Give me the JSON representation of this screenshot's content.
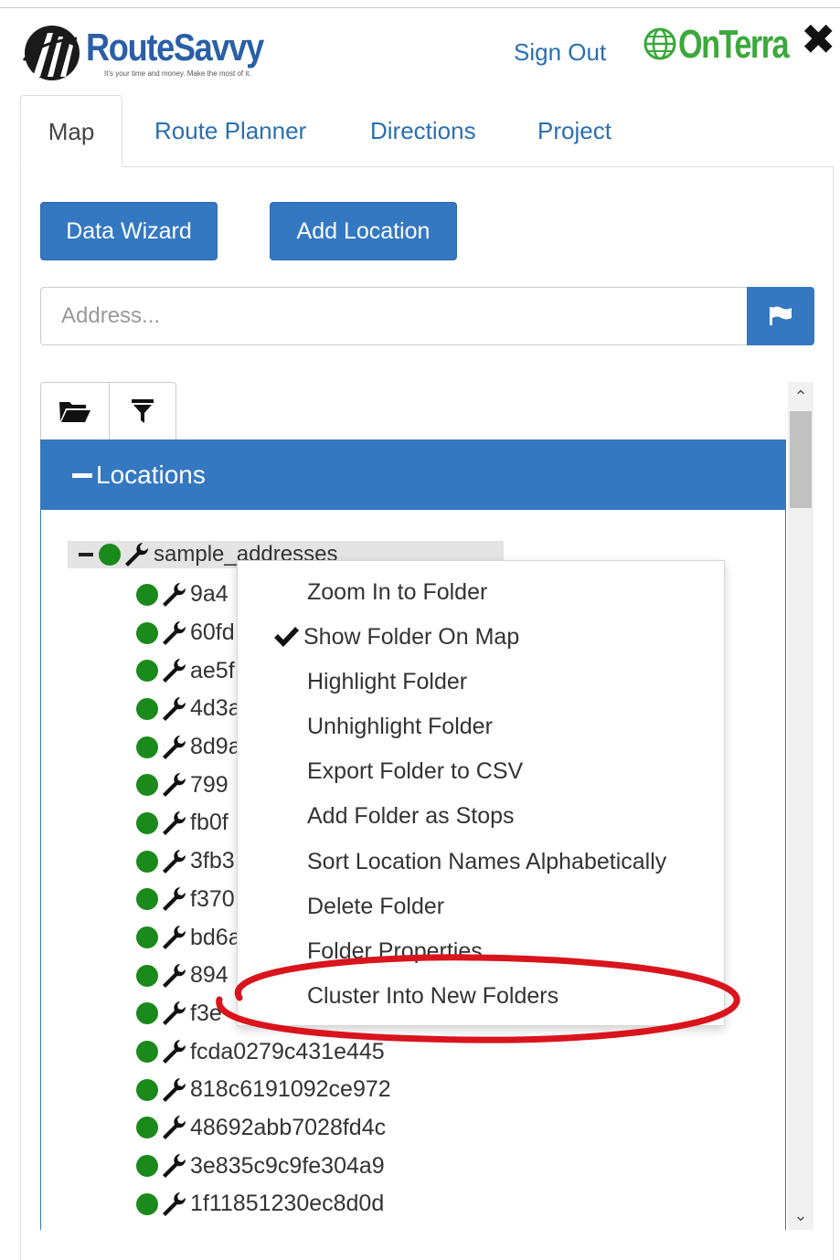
{
  "header": {
    "logo_name": "RouteSavvy",
    "logo_tagline": "It's your time and money. Make the most of it.",
    "sign_out": "Sign Out",
    "partner_logo": "OnTerra",
    "close_icon": "close-icon"
  },
  "tabs": [
    {
      "label": "Map",
      "active": true
    },
    {
      "label": "Route Planner",
      "active": false
    },
    {
      "label": "Directions",
      "active": false
    },
    {
      "label": "Project",
      "active": false
    }
  ],
  "buttons": {
    "data_wizard": "Data Wizard",
    "add_location": "Add Location"
  },
  "address": {
    "placeholder": "Address...",
    "value": "",
    "submit_icon": "flag-icon"
  },
  "toolbar": {
    "open_icon": "folder-open-icon",
    "filter_icon": "filter-icon"
  },
  "locations": {
    "header": "Locations",
    "folder": "sample_addresses",
    "items": [
      "9a4",
      "60fd",
      "ae5f",
      "4d3a",
      "8d9a",
      "799",
      "fb0f",
      "3fb3",
      "f370",
      "bd6a",
      "894",
      "f3e",
      "fcda0279c431e445",
      "818c6191092ce972",
      "48692abb7028fd4c",
      "3e835c9c9fe304a9",
      "1f11851230ec8d0d"
    ]
  },
  "context_menu": {
    "items": [
      {
        "label": "Zoom In to Folder",
        "checked": false
      },
      {
        "label": "Show Folder On Map",
        "checked": true
      },
      {
        "label": "Highlight Folder",
        "checked": false
      },
      {
        "label": "Unhighlight Folder",
        "checked": false
      },
      {
        "label": "Export Folder to CSV",
        "checked": false
      },
      {
        "label": "Add Folder as Stops",
        "checked": false
      },
      {
        "label": "Sort Location Names Alphabetically",
        "checked": false
      },
      {
        "label": "Delete Folder",
        "checked": false
      },
      {
        "label": "Folder Properties",
        "checked": false
      },
      {
        "label": "Cluster Into New Folders",
        "checked": false
      }
    ]
  },
  "colors": {
    "brand_blue": "#3478c1",
    "status_green": "#1a8a1a",
    "annotation_red": "#d9141c"
  }
}
